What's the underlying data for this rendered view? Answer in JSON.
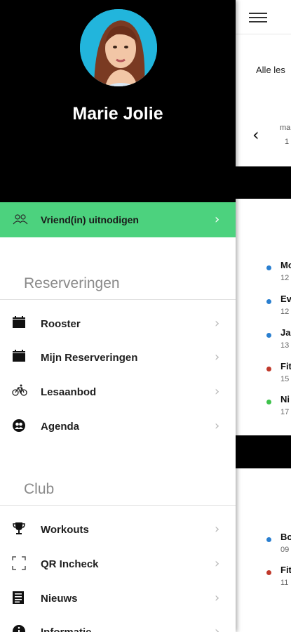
{
  "background_app": {
    "header_text": "Alle les",
    "prev_icon": "chevron-left-icon",
    "day_label": "ma",
    "day_number": "1",
    "schedule_items": [
      {
        "name": "Mo",
        "time": "12",
        "dot_color": "#2a7fd0"
      },
      {
        "name": "Ev",
        "time": "12",
        "dot_color": "#2a7fd0"
      },
      {
        "name": "Ja",
        "time": "13",
        "dot_color": "#2a7fd0"
      },
      {
        "name": "Fit",
        "time": "15",
        "dot_color": "#c0392b"
      },
      {
        "name": "Ni",
        "time": "17",
        "dot_color": "#3ec24b"
      }
    ],
    "schedule_items_2": [
      {
        "name": "Bo",
        "time": "09",
        "dot_color": "#2a7fd0"
      },
      {
        "name": "Fit",
        "time": "11",
        "dot_color": "#c0392b"
      }
    ]
  },
  "drawer": {
    "user_name": "Marie Jolie",
    "invite": {
      "label": "Vriend(in) uitnodigen",
      "icon": "people-icon",
      "color": "#4cd27e"
    },
    "sections": {
      "reserveringen": {
        "title": "Reserveringen",
        "items": [
          {
            "label": "Rooster",
            "icon": "calendar-icon"
          },
          {
            "label": "Mijn Reserveringen",
            "icon": "calendar-icon"
          },
          {
            "label": "Lesaanbod",
            "icon": "bicycle-icon"
          },
          {
            "label": "Agenda",
            "icon": "users-icon"
          }
        ]
      },
      "club": {
        "title": "Club",
        "items": [
          {
            "label": "Workouts",
            "icon": "trophy-icon"
          },
          {
            "label": "QR Incheck",
            "icon": "qr-scan-icon"
          },
          {
            "label": "Nieuws",
            "icon": "news-icon"
          },
          {
            "label": "Informatie",
            "icon": "info-icon"
          }
        ]
      }
    }
  }
}
